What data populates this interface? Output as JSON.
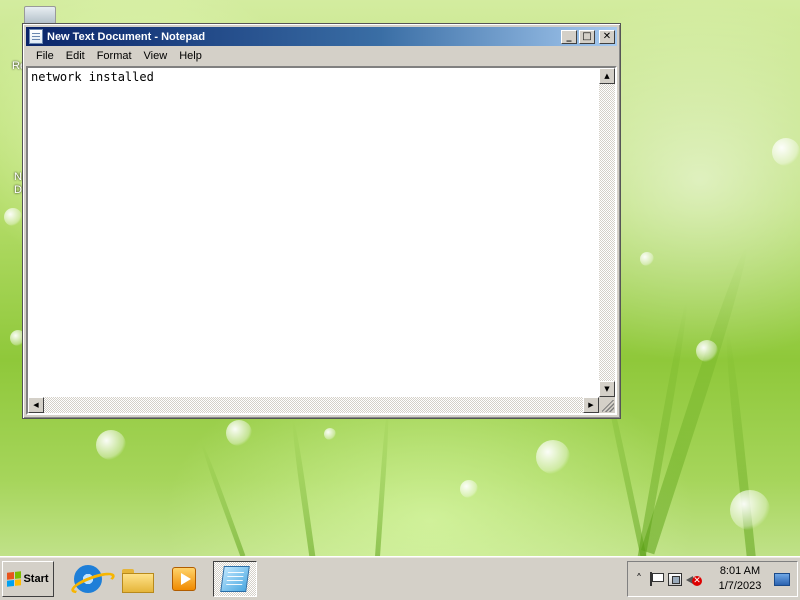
{
  "desktop": {
    "fragments": [
      "Re",
      "N",
      "D"
    ]
  },
  "notepad": {
    "title": "New Text Document - Notepad",
    "controls": {
      "minimize": "_",
      "maximize": "□",
      "close": "✕"
    },
    "menu": [
      "File",
      "Edit",
      "Format",
      "View",
      "Help"
    ],
    "content": "network installed",
    "scroll": {
      "up": "▲",
      "down": "▼",
      "left": "◀",
      "right": "▶"
    }
  },
  "taskbar": {
    "start_label": "Start",
    "pinned": [
      {
        "name": "internet-explorer",
        "icon": "ie-icon"
      },
      {
        "name": "windows-explorer",
        "icon": "folder-icon"
      },
      {
        "name": "media-player",
        "icon": "media-player-icon"
      },
      {
        "name": "notepad",
        "icon": "notepad-icon",
        "active": true
      }
    ],
    "tray": {
      "expand": "˄",
      "time": "8:01 AM",
      "date": "1/7/2023"
    }
  },
  "colors": {
    "titlebar_start": "#0a246a",
    "titlebar_end": "#a6caf0",
    "chrome": "#d4d0c8"
  }
}
